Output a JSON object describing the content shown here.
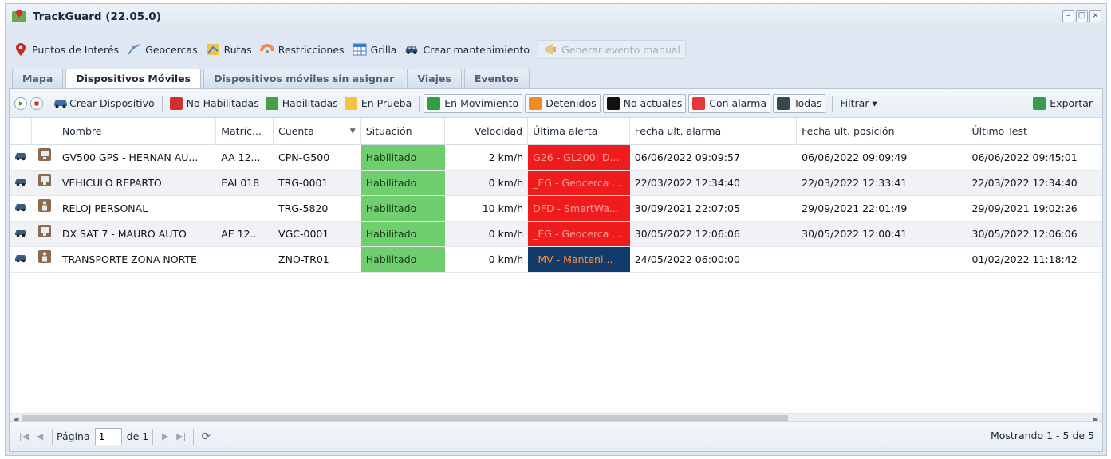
{
  "window": {
    "title": "TrackGuard (22.05.0)"
  },
  "main_toolbar": {
    "items": [
      {
        "label": "Puntos de Interés",
        "icon": "map-pin-icon"
      },
      {
        "label": "Geocercas",
        "icon": "geofence-icon"
      },
      {
        "label": "Rutas",
        "icon": "routes-icon"
      },
      {
        "label": "Restricciones",
        "icon": "restrictions-icon"
      },
      {
        "label": "Grilla",
        "icon": "grid-icon"
      },
      {
        "label": "Crear mantenimiento",
        "icon": "car-icon"
      },
      {
        "label": "Generar evento manual",
        "icon": "megaphone-icon",
        "disabled": true
      }
    ]
  },
  "tabs": [
    {
      "label": "Mapa"
    },
    {
      "label": "Dispositivos Móviles",
      "active": true
    },
    {
      "label": "Dispositivos móviles sin asignar"
    },
    {
      "label": "Viajes"
    },
    {
      "label": "Eventos"
    }
  ],
  "grid_toolbar": {
    "create_device": "Crear Dispositivo",
    "no_habilitadas": "No Habilitadas",
    "habilitadas": "Habilitadas",
    "en_prueba": "En Prueba",
    "en_movimiento": "En Movimiento",
    "detenidos": "Detenidos",
    "no_actuales": "No actuales",
    "con_alarma": "Con alarma",
    "todas": "Todas",
    "filtrar": "Filtrar ▾",
    "exportar": "Exportar"
  },
  "columns": {
    "nombre": "Nombre",
    "matricula": "Matríc...",
    "cuenta": "Cuenta",
    "situacion": "Situación",
    "velocidad": "Velocidad",
    "ultima_alerta": "Última alerta",
    "fecha_alarma": "Fecha ult. alarma",
    "fecha_posicion": "Fecha ult. posición",
    "ultimo_test": "Último Test"
  },
  "rows": [
    {
      "type_icon": "device-tablet-icon",
      "nombre": "GV500 GPS - HERNAN AU...",
      "matricula": "AA 12...",
      "cuenta": "CPN-G500",
      "situacion": "Habilitado",
      "velocidad": "2 km/h",
      "alerta": "G26 - GL200: D...",
      "alerta_style": "red",
      "fecha_alarma": "06/06/2022 09:09:57",
      "fecha_posicion": "06/06/2022 09:09:49",
      "ultimo_test": "06/06/2022 09:45:01"
    },
    {
      "type_icon": "device-tablet-icon",
      "nombre": "VEHICULO REPARTO",
      "matricula": "EAI 018",
      "cuenta": "TRG-0001",
      "situacion": "Habilitado",
      "velocidad": "0 km/h",
      "alerta": "_EG - Geocerca ...",
      "alerta_style": "red",
      "fecha_alarma": "22/03/2022 12:34:40",
      "fecha_posicion": "22/03/2022 12:33:41",
      "ultimo_test": "22/03/2022 12:34:40"
    },
    {
      "type_icon": "person-device-icon",
      "nombre": "RELOJ PERSONAL",
      "matricula": "",
      "cuenta": "TRG-5820",
      "situacion": "Habilitado",
      "velocidad": "10 km/h",
      "alerta": "DFD - SmartWa...",
      "alerta_style": "red",
      "fecha_alarma": "30/09/2021 22:07:05",
      "fecha_posicion": "29/09/2021 22:01:49",
      "ultimo_test": "29/09/2021 19:02:26"
    },
    {
      "type_icon": "device-tablet-icon",
      "nombre": "DX SAT 7 - MAURO AUTO",
      "matricula": "AE 12...",
      "cuenta": "VGC-0001",
      "situacion": "Habilitado",
      "velocidad": "0 km/h",
      "alerta": "_EG - Geocerca ...",
      "alerta_style": "red",
      "fecha_alarma": "30/05/2022 12:06:06",
      "fecha_posicion": "30/05/2022 12:00:41",
      "ultimo_test": "30/05/2022 12:06:06"
    },
    {
      "type_icon": "person-device-icon",
      "nombre": "TRANSPORTE ZONA NORTE",
      "matricula": "",
      "cuenta": "ZNO-TR01",
      "situacion": "Habilitado",
      "velocidad": "0 km/h",
      "alerta": "_MV - Manteni...",
      "alerta_style": "navy",
      "fecha_alarma": "24/05/2022 06:00:00",
      "fecha_posicion": "",
      "ultimo_test": "01/02/2022 11:18:42"
    }
  ],
  "pager": {
    "page_label": "Página",
    "page_value": "1",
    "of_label": "de 1",
    "info": "Mostrando 1 - 5 de 5"
  }
}
